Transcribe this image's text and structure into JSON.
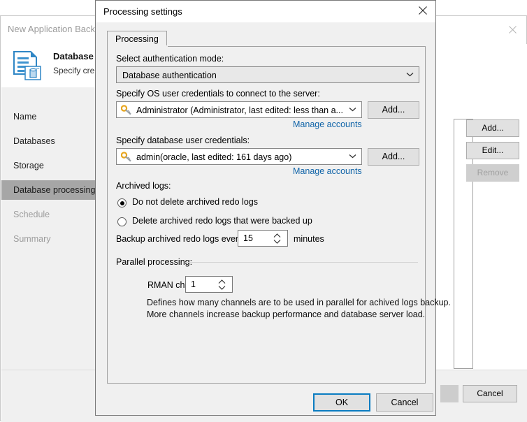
{
  "background_window": {
    "title": "New Application Backup",
    "close_icon": "close-icon",
    "header": {
      "title": "Database p",
      "subtitle": "Specify cred",
      "icon": "database-document-icon"
    },
    "nav_items": [
      {
        "label": "Name",
        "state": "normal"
      },
      {
        "label": "Databases",
        "state": "normal"
      },
      {
        "label": "Storage",
        "state": "normal"
      },
      {
        "label": "Database processing",
        "state": "selected"
      },
      {
        "label": "Schedule",
        "state": "disabled"
      },
      {
        "label": "Summary",
        "state": "disabled"
      }
    ],
    "side_buttons": [
      {
        "label": "Add...",
        "state": "normal"
      },
      {
        "label": "Edit...",
        "state": "normal"
      },
      {
        "label": "Remove",
        "state": "disabled"
      }
    ],
    "cancel_label": "Cancel"
  },
  "dialog": {
    "title": "Processing settings",
    "close_icon": "close-icon",
    "tab": {
      "label": "Processing"
    },
    "auth_mode": {
      "label": "Select authentication mode:",
      "value": "Database authentication",
      "chevron_icon": "chevron-down-icon"
    },
    "os_credentials": {
      "label": "Specify OS user credentials to connect to the server:",
      "value": "Administrator (Administrator, last edited: less than a...",
      "icon": "key-icon",
      "chevron_icon": "chevron-down-icon",
      "add_label": "Add...",
      "manage_label": "Manage accounts"
    },
    "db_credentials": {
      "label": "Specify database user credentials:",
      "value": "admin(oracle, last edited: 161 days ago)",
      "icon": "key-icon",
      "chevron_icon": "chevron-down-icon",
      "add_label": "Add...",
      "manage_label": "Manage accounts"
    },
    "archived_logs": {
      "label": "Archived logs:",
      "option_keep": "Do not delete archived redo logs",
      "option_delete": "Delete archived redo logs that were backed up",
      "selected": "keep",
      "interval_label": "Backup archived redo logs every:",
      "interval_value": "15",
      "interval_units": "minutes",
      "spinner_icon": "spinner-arrows-icon"
    },
    "parallel_processing": {
      "label": "Parallel processing:",
      "rman_label": "RMAN channels:",
      "rman_value": "1",
      "spinner_icon": "spinner-arrows-icon",
      "help_line_1": "Defines how many channels are to be used in parallel for achived logs backup.",
      "help_line_2": "More channels increase backup performance and database server load."
    },
    "footer": {
      "ok_label": "OK",
      "cancel_label": "Cancel"
    }
  },
  "colors": {
    "accent": "#0a7cc1",
    "link": "#1064a8",
    "selected_nav": "#a6a6a6",
    "dialog_bg": "#f0f0f0",
    "key_icon": "#e8a61e"
  }
}
